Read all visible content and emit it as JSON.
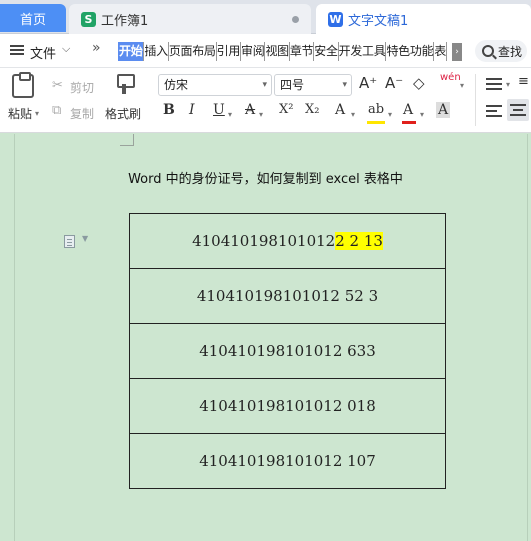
{
  "tabs": {
    "home": "首页",
    "sheet": "工作簿1",
    "doc": "文字文稿1",
    "sheet_icon": "S",
    "doc_icon": "W"
  },
  "menubar": {
    "file": "文件",
    "more": "»",
    "tabs": [
      "开始",
      "插入",
      "页面布局",
      "引用",
      "审阅",
      "视图",
      "章节",
      "安全",
      "开发工具",
      "特色功能",
      "表"
    ],
    "active_tab": "开始",
    "search": "查找"
  },
  "ribbon": {
    "paste": "粘贴",
    "cut": "剪切",
    "copy": "复制",
    "format_painter": "格式刷",
    "font_name": "仿宋",
    "font_size": "四号",
    "grow_font": "A⁺",
    "shrink_font": "A⁻",
    "pinyin": "wén",
    "bold": "B",
    "italic": "I",
    "underline": "U",
    "strikethrough": "A",
    "superscript": "X²",
    "subscript": "X₂",
    "text_effect": "A",
    "highlight": "ab",
    "font_color": "A",
    "char_shading": "A",
    "highlight_color": "#ffe600",
    "font_color_value": "#e0201c"
  },
  "document": {
    "heading": "Word 中的身份证号，如何复制到 excel 表格中",
    "rows": [
      {
        "plain": "410410198101012",
        "highlighted": "2  2  13"
      },
      {
        "plain": "410410198101012  52  3",
        "highlighted": ""
      },
      {
        "plain": "410410198101012  633",
        "highlighted": ""
      },
      {
        "plain": "410410198101012  018",
        "highlighted": ""
      },
      {
        "plain": "410410198101012  107",
        "highlighted": ""
      }
    ]
  }
}
